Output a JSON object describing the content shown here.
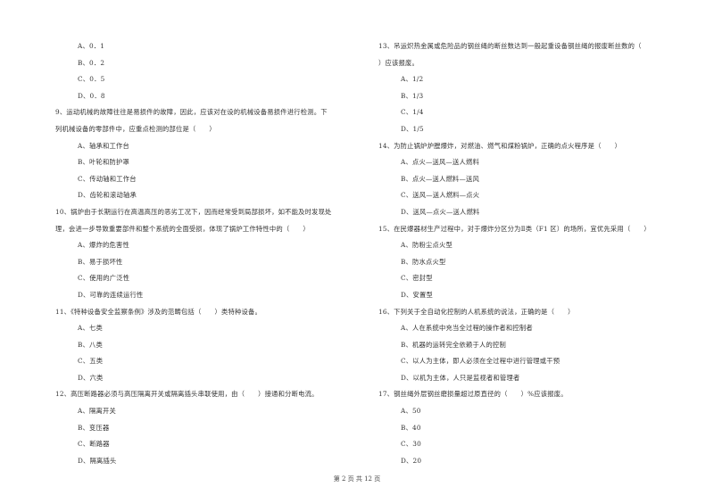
{
  "left_column": [
    {
      "type": "opt",
      "text": "A、0．1"
    },
    {
      "type": "opt",
      "text": "B、0．2"
    },
    {
      "type": "opt",
      "text": "C、0．5"
    },
    {
      "type": "opt",
      "text": "D、0．8"
    },
    {
      "type": "q",
      "text": "9、运动机械的故障往往是易损件的故障，因此，应该对在设的机械设备易损件进行检测。下"
    },
    {
      "type": "q-cont",
      "text": "列机械设备的零部件中，应重点检测的部位是（　　）"
    },
    {
      "type": "opt",
      "text": "A、轴承和工作台"
    },
    {
      "type": "opt",
      "text": "B、叶轮和防护罩"
    },
    {
      "type": "opt",
      "text": "C、传动轴和工作台"
    },
    {
      "type": "opt",
      "text": "D、齿轮和滚动轴承"
    },
    {
      "type": "q",
      "text": "10、锅炉由于长期运行在高温高压的恶劣工况下，因而经常受到局部损坏，如不能及时发现处"
    },
    {
      "type": "q-cont",
      "text": "理，会进一步导致重要部件和整个系统的全面受损，体现了锅炉工作特性中的（　　）"
    },
    {
      "type": "opt",
      "text": "A、爆炸的危害性"
    },
    {
      "type": "opt",
      "text": "B、易于损坏性"
    },
    {
      "type": "opt",
      "text": "C、使用的广泛性"
    },
    {
      "type": "opt",
      "text": "D、可靠的连续运行性"
    },
    {
      "type": "q",
      "text": "11、《特种设备安全监察条例》涉及的范畴包括（　　）类特种设备。"
    },
    {
      "type": "opt",
      "text": "A、七类"
    },
    {
      "type": "opt",
      "text": "B、八类"
    },
    {
      "type": "opt",
      "text": "C、五类"
    },
    {
      "type": "opt",
      "text": "D、六类"
    },
    {
      "type": "q",
      "text": "12、高压断路器必须与高压隔离开关或隔离插头串联使用，由（　　）接通和分断电流。"
    },
    {
      "type": "opt",
      "text": "A、隔离开关"
    },
    {
      "type": "opt",
      "text": "B、变压器"
    },
    {
      "type": "opt",
      "text": "C、断路器"
    },
    {
      "type": "opt",
      "text": "D、隔离插头"
    }
  ],
  "right_column": [
    {
      "type": "q",
      "text": "13、吊运炽热金属或危险品的钢丝绳的断丝数达到一般起重设备钢丝绳的报废断丝数的（"
    },
    {
      "type": "q-cont",
      "text": "）应该报废。"
    },
    {
      "type": "opt",
      "text": "A、1/2"
    },
    {
      "type": "opt",
      "text": "B、1/3"
    },
    {
      "type": "opt",
      "text": "C、1/4"
    },
    {
      "type": "opt",
      "text": "D、1/5"
    },
    {
      "type": "q",
      "text": "14、为防止锅炉炉膛爆炸，对燃油、燃气和煤粉锅炉，正确的点火程序是（　　）"
    },
    {
      "type": "opt",
      "text": "A、点火—送风—送人燃料"
    },
    {
      "type": "opt",
      "text": "B、点火—送人燃料—送风"
    },
    {
      "type": "opt",
      "text": "C、送风—送人燃料—点火"
    },
    {
      "type": "opt",
      "text": "D、送风—点火—送人燃料"
    },
    {
      "type": "q",
      "text": "15、在民爆器材生产过程中，对于爆炸分区分为Ⅱ类（F1 区）的场所，宜优先采用（　　）"
    },
    {
      "type": "opt",
      "text": "A、防粉尘点火型"
    },
    {
      "type": "opt",
      "text": "B、防水点火型"
    },
    {
      "type": "opt",
      "text": "C、密封型"
    },
    {
      "type": "opt",
      "text": "D、安置型"
    },
    {
      "type": "q",
      "text": "16、下列关于全自动化控制的人机系统的说法，正确的是（　　）"
    },
    {
      "type": "opt",
      "text": "A、人在系统中充当全过程的操作者和控制者"
    },
    {
      "type": "opt",
      "text": "B、机器的运转完全依赖于人的控制"
    },
    {
      "type": "opt",
      "text": "C、以人为主体，即人必须在全过程中进行管理或干预"
    },
    {
      "type": "opt",
      "text": "D、以机为主体，人只是监视者和管理者"
    },
    {
      "type": "q",
      "text": "17、钢丝绳外层钢丝磨损量超过原直径的（　　）%应该报废。"
    },
    {
      "type": "opt",
      "text": "A、50"
    },
    {
      "type": "opt",
      "text": "B、40"
    },
    {
      "type": "opt",
      "text": "C、30"
    },
    {
      "type": "opt",
      "text": "D、20"
    }
  ],
  "footer": {
    "page_label": "第 2 页 共 12 页"
  }
}
